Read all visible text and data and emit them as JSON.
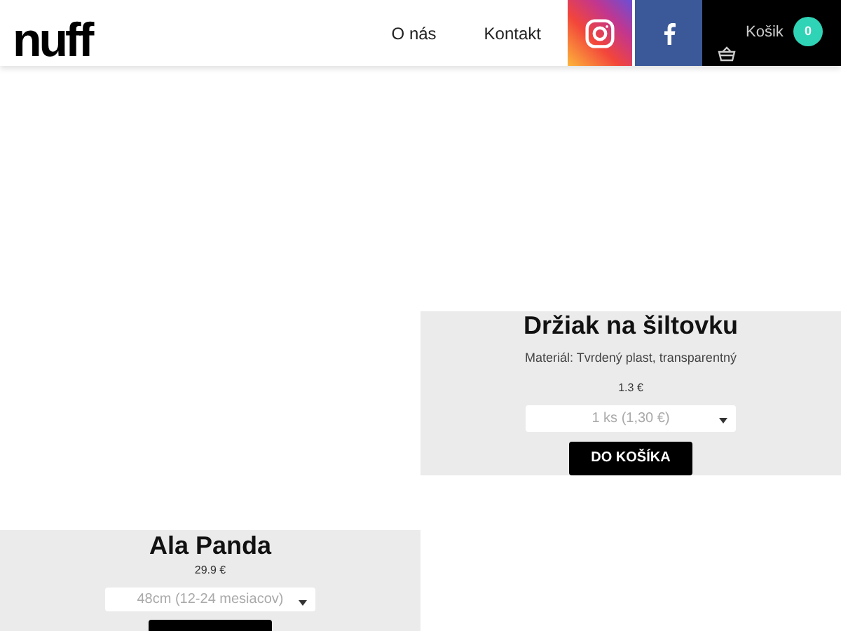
{
  "header": {
    "logo": "nuff",
    "nav": [
      "O nás",
      "Kontakt"
    ],
    "cart": {
      "label": "Košik",
      "count": "0"
    }
  },
  "products": [
    {
      "name": "Ala Panda",
      "price": "29.9 €",
      "option": "48cm (12-24 mesiacov)"
    },
    {
      "name": "Držiak na šiltovku",
      "material": "Materiál: Tvrdený plast, transparentný",
      "price": "1.3 €",
      "option": "1 ks (1,30 €)",
      "button": "DO KOŠÍKA"
    }
  ]
}
